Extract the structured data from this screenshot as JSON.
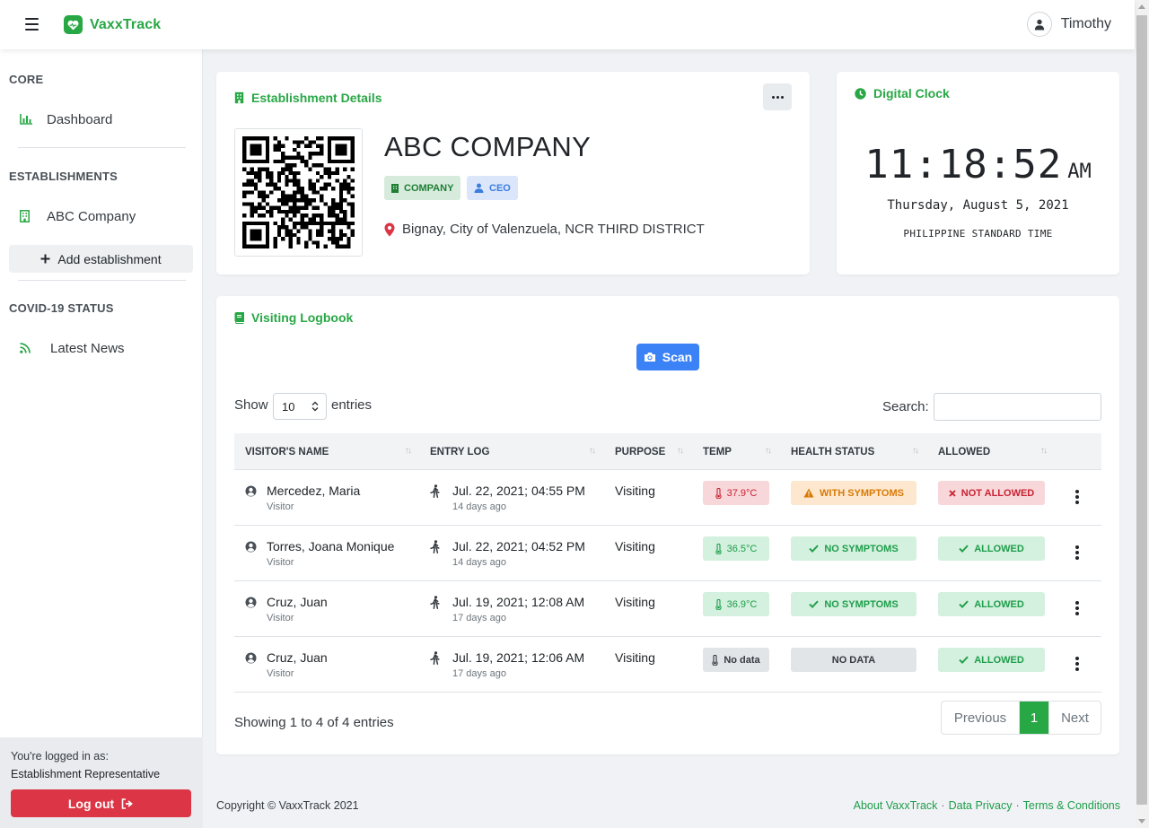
{
  "app": {
    "brand_name": "VaxxTrack",
    "brand_color": "#28a745",
    "user_name": "Timothy"
  },
  "sidebar": {
    "sections": [
      {
        "heading": "CORE",
        "items": [
          {
            "label": "Dashboard",
            "icon": "bar-chart-icon"
          }
        ]
      },
      {
        "heading": "ESTABLISHMENTS",
        "items": [
          {
            "label": "ABC Company",
            "icon": "building-icon"
          }
        ]
      },
      {
        "heading": "COVID-19 STATUS",
        "items": [
          {
            "label": "Latest News",
            "icon": "rss-icon"
          }
        ]
      }
    ],
    "add_establishment": "Add establishment",
    "logged_in_as": "You're logged in as:",
    "role": "Establishment Representative",
    "logout": "Log out"
  },
  "establishment": {
    "card_title": "Establishment Details",
    "name": "ABC COMPANY",
    "type_badge": "COMPANY",
    "role_badge": "CEO",
    "address": "Bignay, City of Valenzuela, NCR THIRD DISTRICT"
  },
  "clock": {
    "card_title": "Digital Clock",
    "time": "11:18:52",
    "ampm": "AM",
    "date": "Thursday, August 5, 2021",
    "timezone": "PHILIPPINE STANDARD TIME"
  },
  "logbook": {
    "card_title": "Visiting Logbook",
    "scan_label": "Scan",
    "show_label": "Show",
    "entries_label": "entries",
    "page_length": "10",
    "search_label": "Search:",
    "search_value": "",
    "columns": [
      "VISITOR'S NAME",
      "ENTRY LOG",
      "PURPOSE",
      "TEMP",
      "HEALTH STATUS",
      "ALLOWED"
    ],
    "rows": [
      {
        "name": "Mercedez, Maria",
        "type": "Visitor",
        "entry": "Jul. 22, 2021; 04:55 PM",
        "ago": "14 days ago",
        "purpose": "Visiting",
        "temp": "37.9°C",
        "temp_status": "high",
        "health": "WITH SYMPTOMS",
        "health_status": "warning",
        "allowed": "NOT ALLOWED",
        "allowed_status": "no"
      },
      {
        "name": "Torres, Joana Monique",
        "type": "Visitor",
        "entry": "Jul. 22, 2021; 04:52 PM",
        "ago": "14 days ago",
        "purpose": "Visiting",
        "temp": "36.5°C",
        "temp_status": "normal",
        "health": "NO SYMPTOMS",
        "health_status": "ok",
        "allowed": "ALLOWED",
        "allowed_status": "yes"
      },
      {
        "name": "Cruz, Juan",
        "type": "Visitor",
        "entry": "Jul. 19, 2021; 12:08 AM",
        "ago": "17 days ago",
        "purpose": "Visiting",
        "temp": "36.9°C",
        "temp_status": "normal",
        "health": "NO SYMPTOMS",
        "health_status": "ok",
        "allowed": "ALLOWED",
        "allowed_status": "yes"
      },
      {
        "name": "Cruz, Juan",
        "type": "Visitor",
        "entry": "Jul. 19, 2021; 12:06 AM",
        "ago": "17 days ago",
        "purpose": "Visiting",
        "temp": "No data",
        "temp_status": "none",
        "health": "NO DATA",
        "health_status": "none",
        "allowed": "ALLOWED",
        "allowed_status": "yes"
      }
    ],
    "info": "Showing 1 to 4 of 4 entries",
    "pager": {
      "previous": "Previous",
      "current": "1",
      "next": "Next"
    }
  },
  "footer": {
    "copyright": "Copyright © VaxxTrack 2021",
    "links": [
      "About VaxxTrack",
      "Data Privacy",
      "Terms & Conditions"
    ],
    "separator": "·"
  }
}
